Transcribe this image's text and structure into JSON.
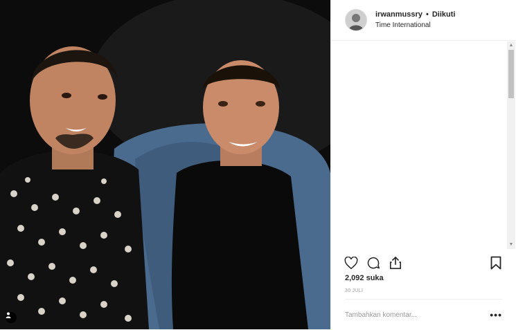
{
  "post": {
    "username": "irwanmussry",
    "separator": "•",
    "follow_status": "Diikuti",
    "location": "Time International",
    "likes": "2,092 suka",
    "date": "30 JULI",
    "comment_placeholder": "Tambahkan komentar...",
    "more_options": "•••"
  },
  "icons": {
    "like": "heart-icon",
    "comment": "comment-icon",
    "share": "share-icon",
    "save": "bookmark-icon",
    "tags": "user-tag-icon"
  }
}
